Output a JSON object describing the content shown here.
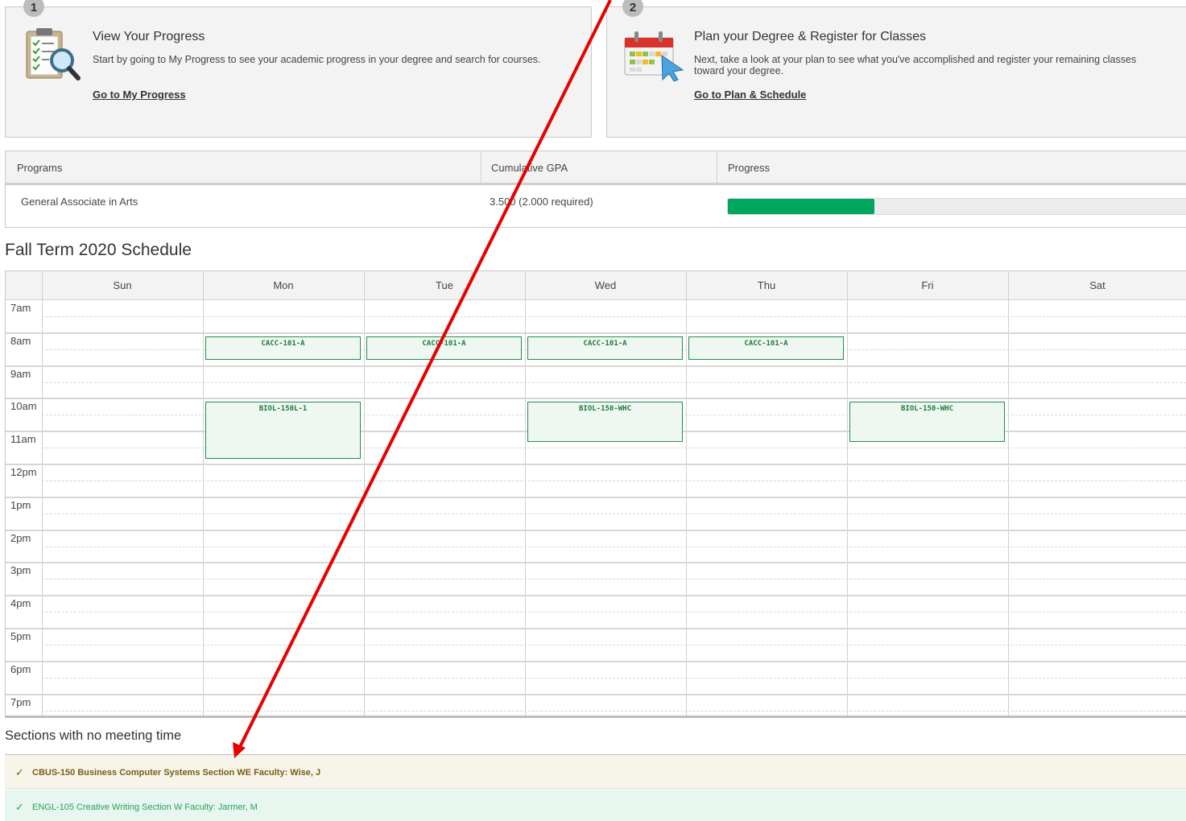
{
  "steps": [
    {
      "number": "1",
      "title": "View Your Progress",
      "description": "Start by going to My Progress to see your academic progress in your degree and search for courses.",
      "link": "Go to My Progress"
    },
    {
      "number": "2",
      "title": "Plan your Degree & Register for Classes",
      "description_line1": "Next, take a look at your plan to see what you've accomplished and register your remaining classes",
      "description_line2": "toward your degree.",
      "link": "Go to Plan & Schedule"
    }
  ],
  "programs": {
    "headers": [
      "Programs",
      "Cumulative GPA",
      "Progress"
    ],
    "rows": [
      {
        "program": "General Associate in Arts",
        "gpa": "3.500 (2.000 required)",
        "progress_fraction": 0.32
      }
    ],
    "progress_color": "#00a55e"
  },
  "schedule": {
    "title": "Fall Term 2020 Schedule",
    "days": [
      "Sun",
      "Mon",
      "Tue",
      "Wed",
      "Thu",
      "Fri",
      "Sat"
    ],
    "times": [
      "7am",
      "8am",
      "9am",
      "10am",
      "11am",
      "12pm",
      "1pm",
      "2pm",
      "3pm",
      "4pm",
      "5pm",
      "6pm",
      "7pm"
    ],
    "events": [
      {
        "label": "CACC-101-A",
        "day": "Mon",
        "start": "8am",
        "end": "8:45am"
      },
      {
        "label": "CACC-101-A",
        "day": "Tue",
        "start": "8am",
        "end": "8:45am"
      },
      {
        "label": "CACC-101-A",
        "day": "Wed",
        "start": "8am",
        "end": "8:45am"
      },
      {
        "label": "CACC-101-A",
        "day": "Thu",
        "start": "8am",
        "end": "8:45am"
      },
      {
        "label": "BIOL-150L-1",
        "day": "Mon",
        "start": "10am",
        "end": "11:45am"
      },
      {
        "label": "BIOL-150-WHC",
        "day": "Wed",
        "start": "10am",
        "end": "11:15am"
      },
      {
        "label": "BIOL-150-WHC",
        "day": "Fri",
        "start": "10am",
        "end": "11:15am"
      }
    ]
  },
  "no_meeting": {
    "title": "Sections with no meeting time",
    "items": [
      {
        "text": "CBUS-150 Business Computer Systems Section WE Faculty: Wise, J",
        "status": "planned"
      },
      {
        "text": "ENGL-105 Creative Writing Section W Faculty: Jarmer, M",
        "status": "registered"
      }
    ]
  },
  "colors": {
    "event_border": "#1f8e4a",
    "event_bg": "#eef7f1",
    "annotation_arrow": "#e60000"
  }
}
